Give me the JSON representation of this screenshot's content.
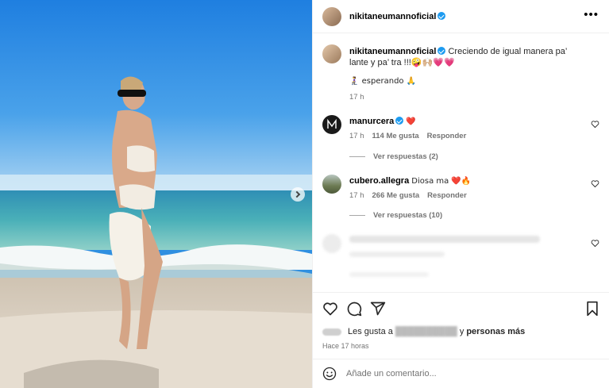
{
  "post": {
    "author": "nikitaneumannoficial",
    "caption": "Creciendo de igual manera pa’ lante y pa’ tra !!!🤪🙌🏼💗💗",
    "caption_line2": "🧎‍♀️ esperando 🙏",
    "caption_time": "17 h"
  },
  "comments": [
    {
      "user": "manurcera",
      "text": "❤️",
      "verified": true,
      "time": "17 h",
      "likes": "114 Me gusta",
      "reply": "Responder",
      "view_replies": "Ver respuestas (2)"
    },
    {
      "user": "cubero.allegra",
      "text": "Diosa ma ❤️🔥",
      "verified": false,
      "time": "17 h",
      "likes": "266 Me gusta",
      "reply": "Responder",
      "view_replies": "Ver respuestas (10)"
    },
    {
      "user": "",
      "text": "",
      "verified": false,
      "time": "",
      "likes": "",
      "reply": "",
      "view_replies": ""
    }
  ],
  "likes_line": {
    "prefix": "Les gusta a",
    "and": "y",
    "others": "personas más"
  },
  "time_ago": "Hace 17 horas",
  "comment_input": {
    "placeholder": "Añade un comentario..."
  },
  "icons": {
    "more": "more-horizontal-icon",
    "like": "heart-icon",
    "comment": "comment-bubble-icon",
    "share": "paper-plane-icon",
    "save": "bookmark-icon",
    "emoji": "emoji-smile-icon",
    "next": "chevron-right-icon"
  },
  "colors": {
    "verified": "#1d9bf0",
    "heart": "#e0245e",
    "secondary_text": "#737373"
  }
}
